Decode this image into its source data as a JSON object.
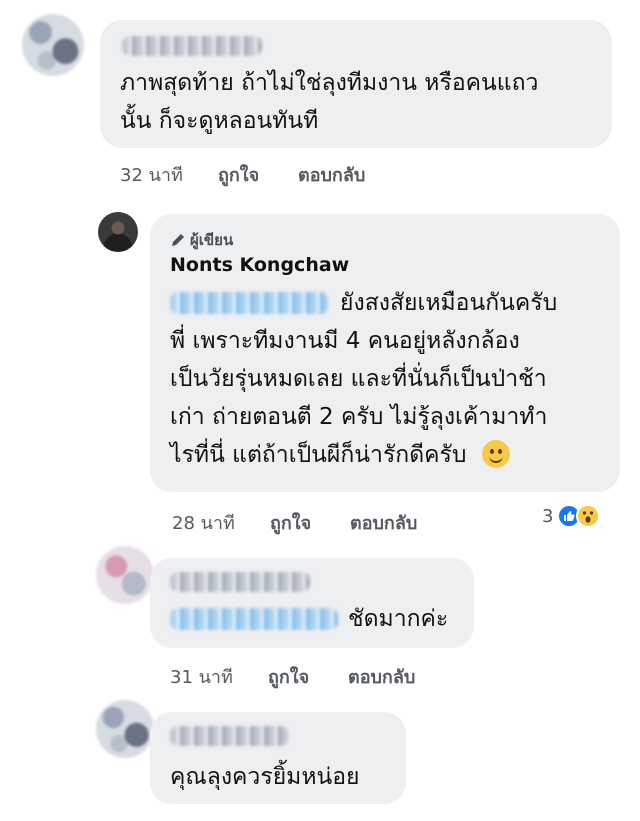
{
  "comments": [
    {
      "author_visible": false,
      "text_lines": [
        "ภาพสุดท้าย ถ้าไม่ใช่ลุงทีมงาน หรือคนแถว",
        "นั้น ก็จะดูหลอนทันที"
      ],
      "time": "32 นาที",
      "like_label": "ถูกใจ",
      "reply_label": "ตอบกลับ"
    },
    {
      "author_tag": "ผู้เขียน",
      "author_name": "Nonts Kongchaw",
      "text_lines": [
        "ยังสงสัยเหมือนกันครับ",
        "พี่ เพราะทีมงานมี 4 คนอยู่หลังกล้อง",
        "เป็นวัยรุ่นหมดเลย  และที่นั่นก็เป็นป่าช้า",
        "เก่า ถ่ายตอนตี 2 ครับ ไม่รู้ลุงเค้ามาทำ",
        "ไรที่นี่ แต่ถ้าเป็นผีก็น่ารักดีครับ"
      ],
      "time": "28 นาที",
      "like_label": "ถูกใจ",
      "reply_label": "ตอบกลับ",
      "reaction_count": "3",
      "reactions": [
        "like-icon",
        "wow-icon"
      ],
      "inline_emoji": "smile-emoji"
    },
    {
      "text_lines": [
        "ชัดมากค่ะ"
      ],
      "time": "31 นาที",
      "like_label": "ถูกใจ",
      "reply_label": "ตอบกลับ"
    },
    {
      "text_lines": [
        "คุณลุงควรยิ้มหน่อย"
      ]
    }
  ],
  "colors": {
    "bubble": "#eeeff1",
    "like_blue": "#1877f2",
    "wow_yellow": "#f7c948",
    "meta_text": "#555a61"
  }
}
